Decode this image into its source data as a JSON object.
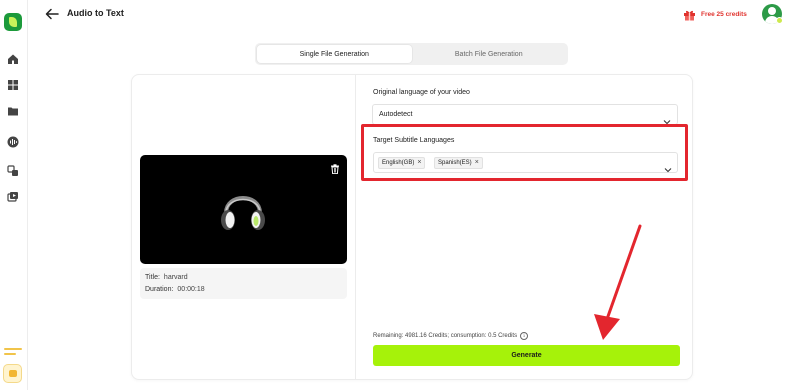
{
  "header": {
    "title": "Audio to Text",
    "credits_label": "Free 25 credits"
  },
  "tabs": [
    {
      "label": "Single File Generation",
      "active": true
    },
    {
      "label": "Batch File Generation",
      "active": false
    }
  ],
  "video": {
    "title_key": "Title:",
    "title_value": "harvard",
    "duration_key": "Duration:",
    "duration_value": "00:00:18"
  },
  "form": {
    "original_language_label": "Original language of your video",
    "original_language_value": "Autodetect",
    "target_label": "Target Subtitle Languages",
    "target_languages": [
      "English(GB)",
      "Spanish(ES)"
    ],
    "chip_remove_glyph": "×",
    "remaining_text": "Remaining: 4981.16 Credits; consumption: 0.5 Credits",
    "info_glyph": "i",
    "generate_label": "Generate"
  },
  "icons": {
    "rail": [
      "home-icon",
      "apps-grid-icon",
      "folder-icon",
      "audio-wave-icon",
      "translate-icon",
      "video-export-icon"
    ],
    "back": "arrow-left-icon",
    "trash": "trash-icon",
    "media": "headphones-icon"
  },
  "colors": {
    "accent_green": "#a6f20a",
    "highlight_red": "#e3262e",
    "credits_red": "#e0322d",
    "brand_green": "#1c9a3b"
  }
}
